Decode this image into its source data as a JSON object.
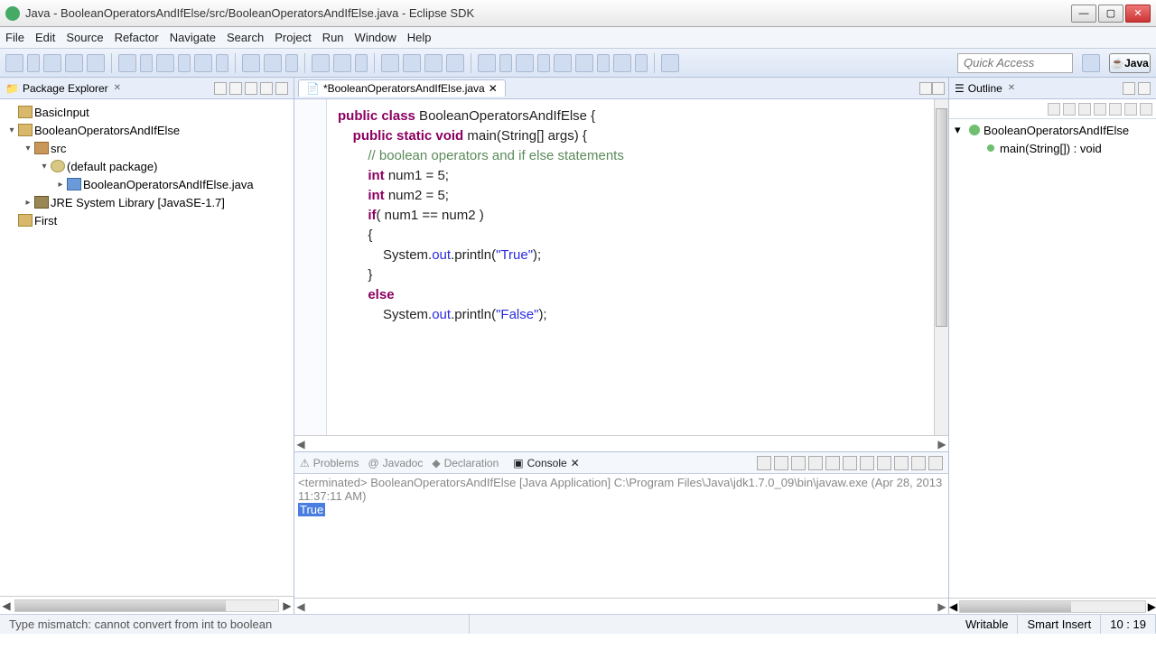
{
  "window": {
    "title": "Java - BooleanOperatorsAndIfElse/src/BooleanOperatorsAndIfElse.java - Eclipse SDK"
  },
  "menu": [
    "File",
    "Edit",
    "Source",
    "Refactor",
    "Navigate",
    "Search",
    "Project",
    "Run",
    "Window",
    "Help"
  ],
  "quick_access_placeholder": "Quick Access",
  "perspective": "Java",
  "package_explorer": {
    "title": "Package Explorer",
    "items": [
      {
        "depth": 0,
        "twist": "",
        "icon": "proj",
        "label": "BasicInput"
      },
      {
        "depth": 0,
        "twist": "▾",
        "icon": "proj",
        "label": "BooleanOperatorsAndIfElse"
      },
      {
        "depth": 1,
        "twist": "▾",
        "icon": "src",
        "label": "src"
      },
      {
        "depth": 2,
        "twist": "▾",
        "icon": "pkg",
        "label": "(default package)"
      },
      {
        "depth": 3,
        "twist": "▸",
        "icon": "java",
        "label": "BooleanOperatorsAndIfElse.java"
      },
      {
        "depth": 1,
        "twist": "▸",
        "icon": "lib",
        "label": "JRE System Library [JavaSE-1.7]"
      },
      {
        "depth": 0,
        "twist": "",
        "icon": "proj",
        "label": "First"
      }
    ]
  },
  "editor": {
    "tab_label": "*BooleanOperatorsAndIfElse.java",
    "code_lines": [
      {
        "indent": 0,
        "tokens": [
          [
            "kw",
            "public"
          ],
          [
            "pl",
            " "
          ],
          [
            "kw",
            "class"
          ],
          [
            "pl",
            " BooleanOperatorsAndIfElse {"
          ]
        ]
      },
      {
        "indent": 0,
        "tokens": [
          [
            "pl",
            ""
          ]
        ]
      },
      {
        "indent": 1,
        "tokens": [
          [
            "kw",
            "public"
          ],
          [
            "pl",
            " "
          ],
          [
            "kw",
            "static"
          ],
          [
            "pl",
            " "
          ],
          [
            "kw",
            "void"
          ],
          [
            "pl",
            " main(String[] args) {"
          ]
        ]
      },
      {
        "indent": 0,
        "tokens": [
          [
            "pl",
            ""
          ]
        ]
      },
      {
        "indent": 2,
        "tokens": [
          [
            "cm",
            "// boolean operators and if else statements"
          ]
        ]
      },
      {
        "indent": 2,
        "tokens": [
          [
            "kw",
            "int"
          ],
          [
            "pl",
            " num1 = 5;"
          ]
        ]
      },
      {
        "indent": 2,
        "tokens": [
          [
            "kw",
            "int"
          ],
          [
            "pl",
            " num2 = 5;"
          ]
        ]
      },
      {
        "indent": 0,
        "tokens": [
          [
            "pl",
            ""
          ]
        ]
      },
      {
        "indent": 2,
        "tokens": [
          [
            "kw",
            "if"
          ],
          [
            "pl",
            "( num1 == num2 )"
          ]
        ]
      },
      {
        "indent": 2,
        "tokens": [
          [
            "pl",
            "{"
          ]
        ]
      },
      {
        "indent": 3,
        "tokens": [
          [
            "pl",
            "System."
          ],
          [
            "fld",
            "out"
          ],
          [
            "pl",
            ".println("
          ],
          [
            "str",
            "\"True\""
          ],
          [
            "pl",
            ");"
          ]
        ]
      },
      {
        "indent": 2,
        "tokens": [
          [
            "pl",
            "}"
          ]
        ]
      },
      {
        "indent": 2,
        "tokens": [
          [
            "kw",
            "else"
          ]
        ]
      },
      {
        "indent": 3,
        "tokens": [
          [
            "pl",
            "System."
          ],
          [
            "fld",
            "out"
          ],
          [
            "pl",
            ".println("
          ],
          [
            "str",
            "\"False\""
          ],
          [
            "pl",
            ");"
          ]
        ]
      }
    ]
  },
  "outline": {
    "title": "Outline",
    "items": [
      {
        "depth": 0,
        "twist": "▾",
        "kind": "class",
        "label": "BooleanOperatorsAndIfElse"
      },
      {
        "depth": 1,
        "twist": "",
        "kind": "meth",
        "label": "main(String[]) : void"
      }
    ]
  },
  "bottom_tabs": [
    "Problems",
    "Javadoc",
    "Declaration",
    "Console"
  ],
  "console": {
    "header": "<terminated> BooleanOperatorsAndIfElse [Java Application] C:\\Program Files\\Java\\jdk1.7.0_09\\bin\\javaw.exe (Apr 28, 2013 11:37:11 AM)",
    "output": "True"
  },
  "status": {
    "error": "Type mismatch: cannot convert from int to boolean",
    "writable": "Writable",
    "insert": "Smart Insert",
    "cursor": "10 : 19"
  }
}
